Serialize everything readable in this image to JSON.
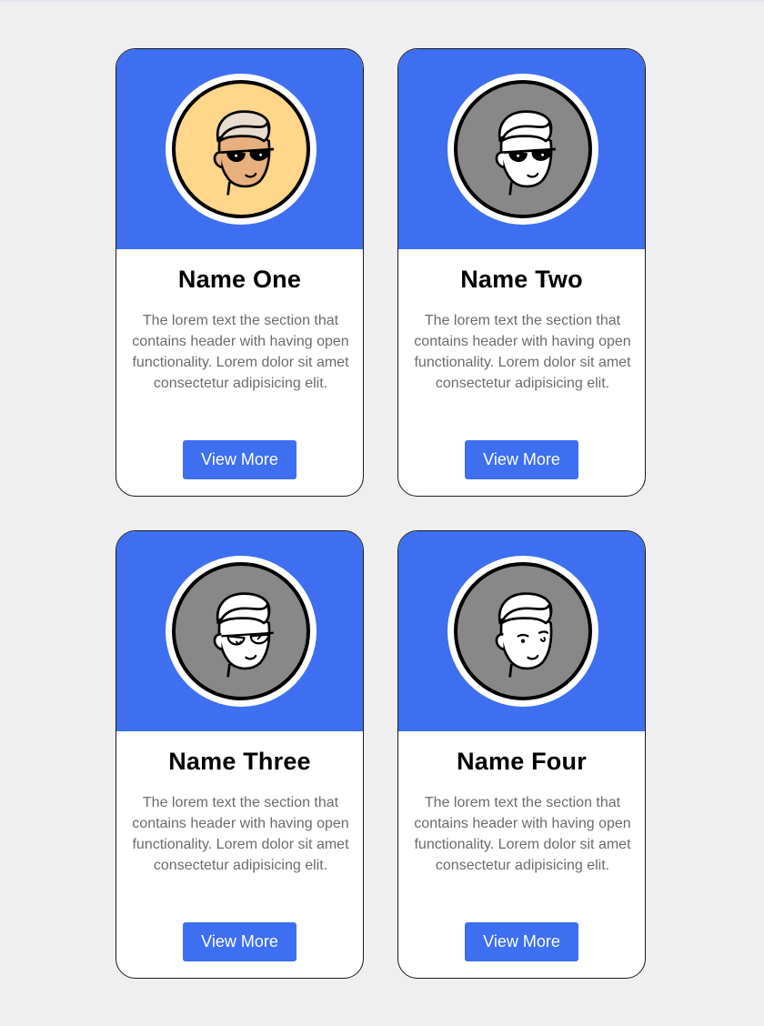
{
  "colors": {
    "page_background": "#efefef",
    "card_header": "#3d6ff0",
    "button": "#3d6ff0",
    "button_text": "#ffffff",
    "avatar_bg_highlight": "#ffd68a",
    "avatar_bg_default": "#888888",
    "skin_tone": "#e8b07e"
  },
  "cards": [
    {
      "name": "Name One",
      "description": "The lorem text the section that contains header with having open functionality. Lorem dolor sit amet consectetur adipisicing elit.",
      "button_label": "View More",
      "avatar_icon": "cartoon-face-sunglasses-icon"
    },
    {
      "name": "Name Two",
      "description": "The lorem text the section that contains header with having open functionality. Lorem dolor sit amet consectetur adipisicing elit.",
      "button_label": "View More",
      "avatar_icon": "cartoon-face-sunglasses-icon"
    },
    {
      "name": "Name Three",
      "description": "The lorem text the section that contains header with having open functionality. Lorem dolor sit amet consectetur adipisicing elit.",
      "button_label": "View More",
      "avatar_icon": "cartoon-face-glasses-icon"
    },
    {
      "name": "Name Four",
      "description": "The lorem text the section that contains header with having open functionality. Lorem dolor sit amet consectetur adipisicing elit.",
      "button_label": "View More",
      "avatar_icon": "cartoon-face-smirk-icon"
    }
  ]
}
